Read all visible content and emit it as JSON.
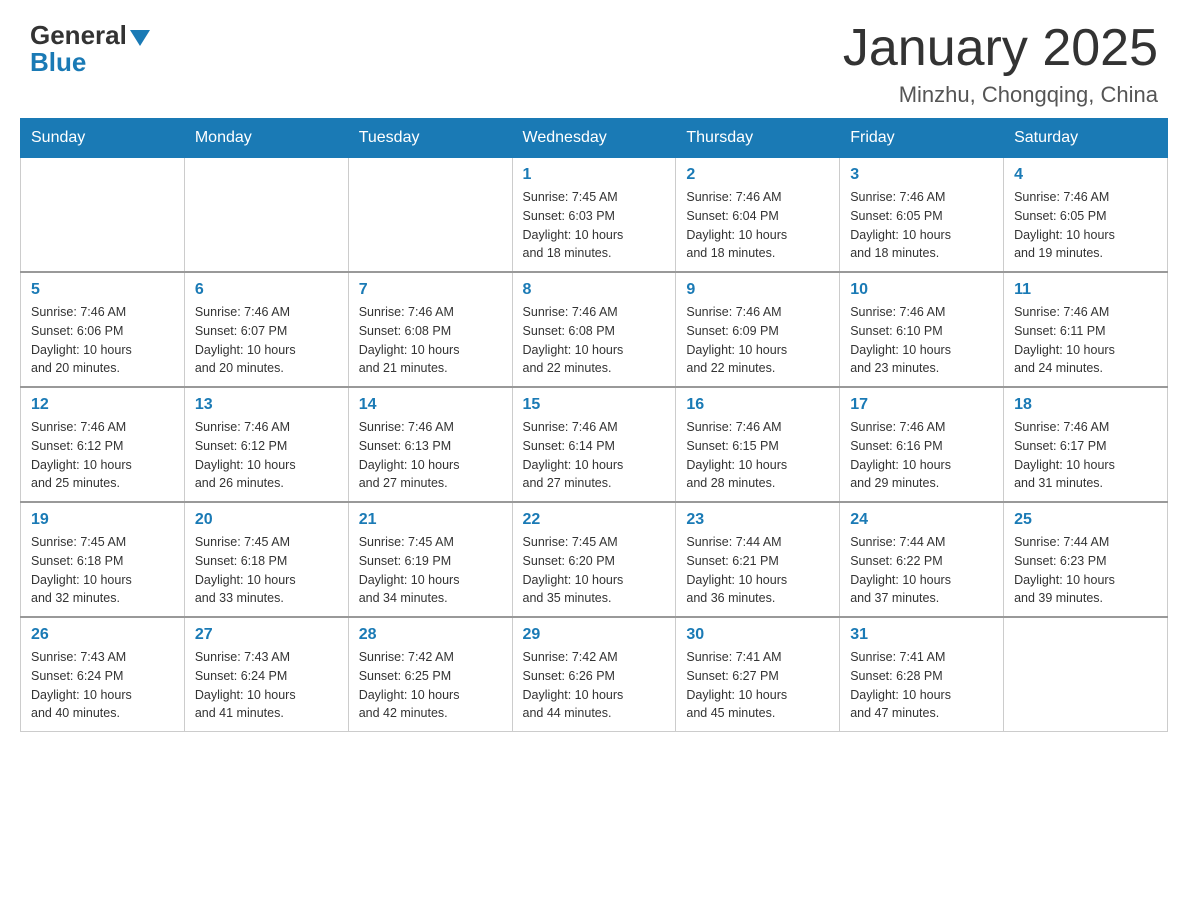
{
  "header": {
    "logo": {
      "general": "General",
      "blue": "Blue"
    },
    "title": "January 2025",
    "location": "Minzhu, Chongqing, China"
  },
  "weekdays": [
    "Sunday",
    "Monday",
    "Tuesday",
    "Wednesday",
    "Thursday",
    "Friday",
    "Saturday"
  ],
  "weeks": [
    [
      {
        "day": "",
        "info": ""
      },
      {
        "day": "",
        "info": ""
      },
      {
        "day": "",
        "info": ""
      },
      {
        "day": "1",
        "info": "Sunrise: 7:45 AM\nSunset: 6:03 PM\nDaylight: 10 hours\nand 18 minutes."
      },
      {
        "day": "2",
        "info": "Sunrise: 7:46 AM\nSunset: 6:04 PM\nDaylight: 10 hours\nand 18 minutes."
      },
      {
        "day": "3",
        "info": "Sunrise: 7:46 AM\nSunset: 6:05 PM\nDaylight: 10 hours\nand 18 minutes."
      },
      {
        "day": "4",
        "info": "Sunrise: 7:46 AM\nSunset: 6:05 PM\nDaylight: 10 hours\nand 19 minutes."
      }
    ],
    [
      {
        "day": "5",
        "info": "Sunrise: 7:46 AM\nSunset: 6:06 PM\nDaylight: 10 hours\nand 20 minutes."
      },
      {
        "day": "6",
        "info": "Sunrise: 7:46 AM\nSunset: 6:07 PM\nDaylight: 10 hours\nand 20 minutes."
      },
      {
        "day": "7",
        "info": "Sunrise: 7:46 AM\nSunset: 6:08 PM\nDaylight: 10 hours\nand 21 minutes."
      },
      {
        "day": "8",
        "info": "Sunrise: 7:46 AM\nSunset: 6:08 PM\nDaylight: 10 hours\nand 22 minutes."
      },
      {
        "day": "9",
        "info": "Sunrise: 7:46 AM\nSunset: 6:09 PM\nDaylight: 10 hours\nand 22 minutes."
      },
      {
        "day": "10",
        "info": "Sunrise: 7:46 AM\nSunset: 6:10 PM\nDaylight: 10 hours\nand 23 minutes."
      },
      {
        "day": "11",
        "info": "Sunrise: 7:46 AM\nSunset: 6:11 PM\nDaylight: 10 hours\nand 24 minutes."
      }
    ],
    [
      {
        "day": "12",
        "info": "Sunrise: 7:46 AM\nSunset: 6:12 PM\nDaylight: 10 hours\nand 25 minutes."
      },
      {
        "day": "13",
        "info": "Sunrise: 7:46 AM\nSunset: 6:12 PM\nDaylight: 10 hours\nand 26 minutes."
      },
      {
        "day": "14",
        "info": "Sunrise: 7:46 AM\nSunset: 6:13 PM\nDaylight: 10 hours\nand 27 minutes."
      },
      {
        "day": "15",
        "info": "Sunrise: 7:46 AM\nSunset: 6:14 PM\nDaylight: 10 hours\nand 27 minutes."
      },
      {
        "day": "16",
        "info": "Sunrise: 7:46 AM\nSunset: 6:15 PM\nDaylight: 10 hours\nand 28 minutes."
      },
      {
        "day": "17",
        "info": "Sunrise: 7:46 AM\nSunset: 6:16 PM\nDaylight: 10 hours\nand 29 minutes."
      },
      {
        "day": "18",
        "info": "Sunrise: 7:46 AM\nSunset: 6:17 PM\nDaylight: 10 hours\nand 31 minutes."
      }
    ],
    [
      {
        "day": "19",
        "info": "Sunrise: 7:45 AM\nSunset: 6:18 PM\nDaylight: 10 hours\nand 32 minutes."
      },
      {
        "day": "20",
        "info": "Sunrise: 7:45 AM\nSunset: 6:18 PM\nDaylight: 10 hours\nand 33 minutes."
      },
      {
        "day": "21",
        "info": "Sunrise: 7:45 AM\nSunset: 6:19 PM\nDaylight: 10 hours\nand 34 minutes."
      },
      {
        "day": "22",
        "info": "Sunrise: 7:45 AM\nSunset: 6:20 PM\nDaylight: 10 hours\nand 35 minutes."
      },
      {
        "day": "23",
        "info": "Sunrise: 7:44 AM\nSunset: 6:21 PM\nDaylight: 10 hours\nand 36 minutes."
      },
      {
        "day": "24",
        "info": "Sunrise: 7:44 AM\nSunset: 6:22 PM\nDaylight: 10 hours\nand 37 minutes."
      },
      {
        "day": "25",
        "info": "Sunrise: 7:44 AM\nSunset: 6:23 PM\nDaylight: 10 hours\nand 39 minutes."
      }
    ],
    [
      {
        "day": "26",
        "info": "Sunrise: 7:43 AM\nSunset: 6:24 PM\nDaylight: 10 hours\nand 40 minutes."
      },
      {
        "day": "27",
        "info": "Sunrise: 7:43 AM\nSunset: 6:24 PM\nDaylight: 10 hours\nand 41 minutes."
      },
      {
        "day": "28",
        "info": "Sunrise: 7:42 AM\nSunset: 6:25 PM\nDaylight: 10 hours\nand 42 minutes."
      },
      {
        "day": "29",
        "info": "Sunrise: 7:42 AM\nSunset: 6:26 PM\nDaylight: 10 hours\nand 44 minutes."
      },
      {
        "day": "30",
        "info": "Sunrise: 7:41 AM\nSunset: 6:27 PM\nDaylight: 10 hours\nand 45 minutes."
      },
      {
        "day": "31",
        "info": "Sunrise: 7:41 AM\nSunset: 6:28 PM\nDaylight: 10 hours\nand 47 minutes."
      },
      {
        "day": "",
        "info": ""
      }
    ]
  ]
}
